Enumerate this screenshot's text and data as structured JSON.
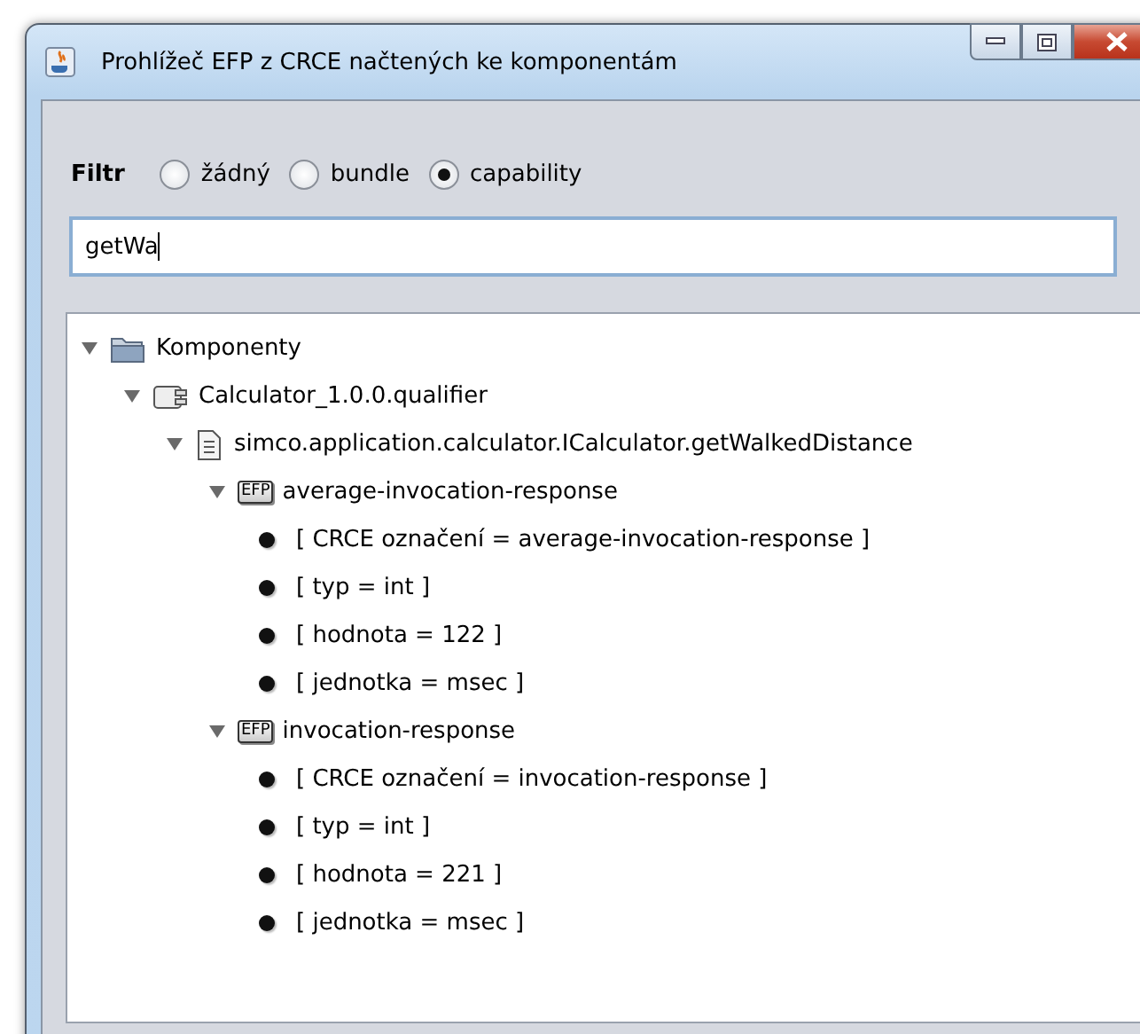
{
  "window": {
    "title": "Prohlížeč EFP z CRCE načtených ke komponentám"
  },
  "filter": {
    "label": "Filtr",
    "options": [
      {
        "label": "žádný",
        "selected": false
      },
      {
        "label": "bundle",
        "selected": false
      },
      {
        "label": "capability",
        "selected": true
      }
    ]
  },
  "search": {
    "value": "getWa"
  },
  "tree": [
    {
      "label": "Komponenty",
      "kind": "folder",
      "expanded": true,
      "children": [
        {
          "label": "Calculator_1.0.0.qualifier",
          "kind": "component",
          "expanded": true,
          "children": [
            {
              "label": "simco.application.calculator.ICalculator.getWalkedDistance",
              "kind": "file",
              "expanded": true,
              "children": [
                {
                  "label": "average-invocation-response",
                  "kind": "efp",
                  "icon_label": "EFP",
                  "expanded": true,
                  "children": [
                    {
                      "label": "[ CRCE označení  = average-invocation-response ]",
                      "kind": "property"
                    },
                    {
                      "label": "[ typ = int ]",
                      "kind": "property"
                    },
                    {
                      "label": "[ hodnota = 122 ]",
                      "kind": "property"
                    },
                    {
                      "label": "[ jednotka  = msec ]",
                      "kind": "property"
                    }
                  ]
                },
                {
                  "label": "invocation-response",
                  "kind": "efp",
                  "icon_label": "EFP",
                  "expanded": true,
                  "children": [
                    {
                      "label": "[ CRCE označení  = invocation-response ]",
                      "kind": "property"
                    },
                    {
                      "label": "[ typ = int ]",
                      "kind": "property"
                    },
                    {
                      "label": "[ hodnota = 221 ]",
                      "kind": "property"
                    },
                    {
                      "label": "[ jednotka  = msec ]",
                      "kind": "property"
                    }
                  ]
                }
              ]
            }
          ]
        }
      ]
    }
  ]
}
